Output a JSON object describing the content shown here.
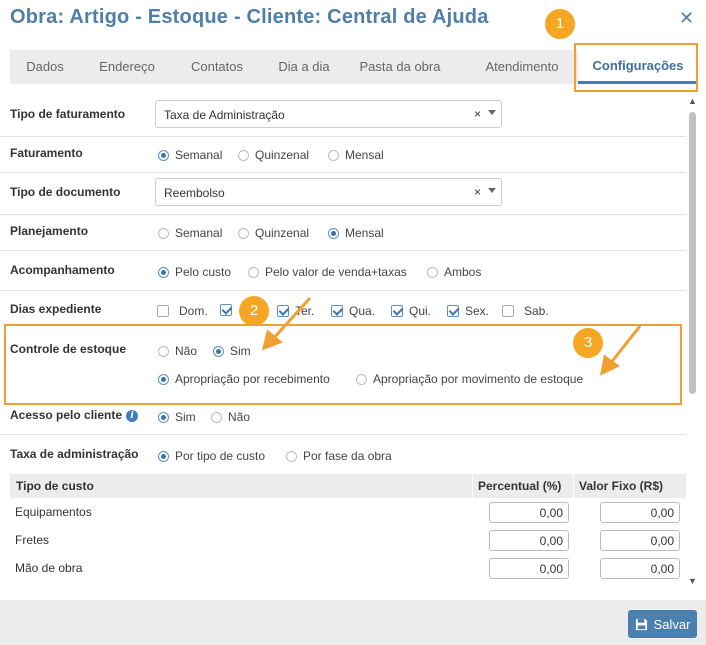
{
  "window": {
    "title": "Obra: Artigo - Estoque - Cliente: Central de Ajuda"
  },
  "tabs": [
    {
      "label": "Dados"
    },
    {
      "label": "Endereço"
    },
    {
      "label": "Contatos"
    },
    {
      "label": "Dia a dia"
    },
    {
      "label": "Pasta da obra"
    },
    {
      "label": "Atendimento"
    },
    {
      "label": "Configurações",
      "active": true
    }
  ],
  "form": {
    "tipo_faturamento": {
      "label": "Tipo de faturamento",
      "value": "Taxa de Administração",
      "clear": "×"
    },
    "faturamento": {
      "label": "Faturamento",
      "options": [
        "Semanal",
        "Quinzenal",
        "Mensal"
      ],
      "selected": "Semanal"
    },
    "tipo_documento": {
      "label": "Tipo de documento",
      "value": "Reembolso",
      "clear": "×"
    },
    "planejamento": {
      "label": "Planejamento",
      "options": [
        "Semanal",
        "Quinzenal",
        "Mensal"
      ],
      "selected": "Mensal"
    },
    "acompanhamento": {
      "label": "Acompanhamento",
      "options": [
        "Pelo custo",
        "Pelo valor de venda+taxas",
        "Ambos"
      ],
      "selected": "Pelo custo"
    },
    "dias_expediente": {
      "label": "Dias expediente",
      "days": [
        {
          "label": "Dom.",
          "checked": false
        },
        {
          "label": "",
          "checked": true
        },
        {
          "label": "Ter.",
          "checked": true
        },
        {
          "label": "Qua.",
          "checked": true
        },
        {
          "label": "Qui.",
          "checked": true
        },
        {
          "label": "Sex.",
          "checked": true
        },
        {
          "label": "Sab.",
          "checked": false
        }
      ]
    },
    "controle_estoque": {
      "label": "Controle de estoque",
      "options": [
        "Não",
        "Sim"
      ],
      "selected": "Sim",
      "apropriacao_options": [
        "Apropriação por recebimento",
        "Apropriação por movimento de estoque"
      ],
      "apropriacao_selected": "Apropriação por recebimento"
    },
    "acesso_cliente": {
      "label": "Acesso pelo cliente",
      "info": "i",
      "options": [
        "Sim",
        "Não"
      ],
      "selected": "Sim"
    },
    "taxa_administracao": {
      "label": "Taxa de administração",
      "options": [
        "Por tipo de custo",
        "Por fase da obra"
      ],
      "selected": "Por tipo de custo"
    }
  },
  "cost_table": {
    "headers": [
      "Tipo de custo",
      "Percentual (%)",
      "Valor Fixo (R$)"
    ],
    "rows": [
      {
        "tipo": "Equipamentos",
        "percentual": "0,00",
        "valor": "0,00"
      },
      {
        "tipo": "Fretes",
        "percentual": "0,00",
        "valor": "0,00"
      },
      {
        "tipo": "Mão de obra",
        "percentual": "0,00",
        "valor": "0,00"
      }
    ]
  },
  "annotations": {
    "badge1": "1",
    "badge2": "2",
    "badge3": "3",
    "color": "#f5a623"
  },
  "footer": {
    "save_label": "Salvar"
  },
  "colors": {
    "title": "#4f7ea8",
    "accent": "#3f7fbd",
    "save_button": "#4a7fb0",
    "annotation": "#f0a030"
  }
}
